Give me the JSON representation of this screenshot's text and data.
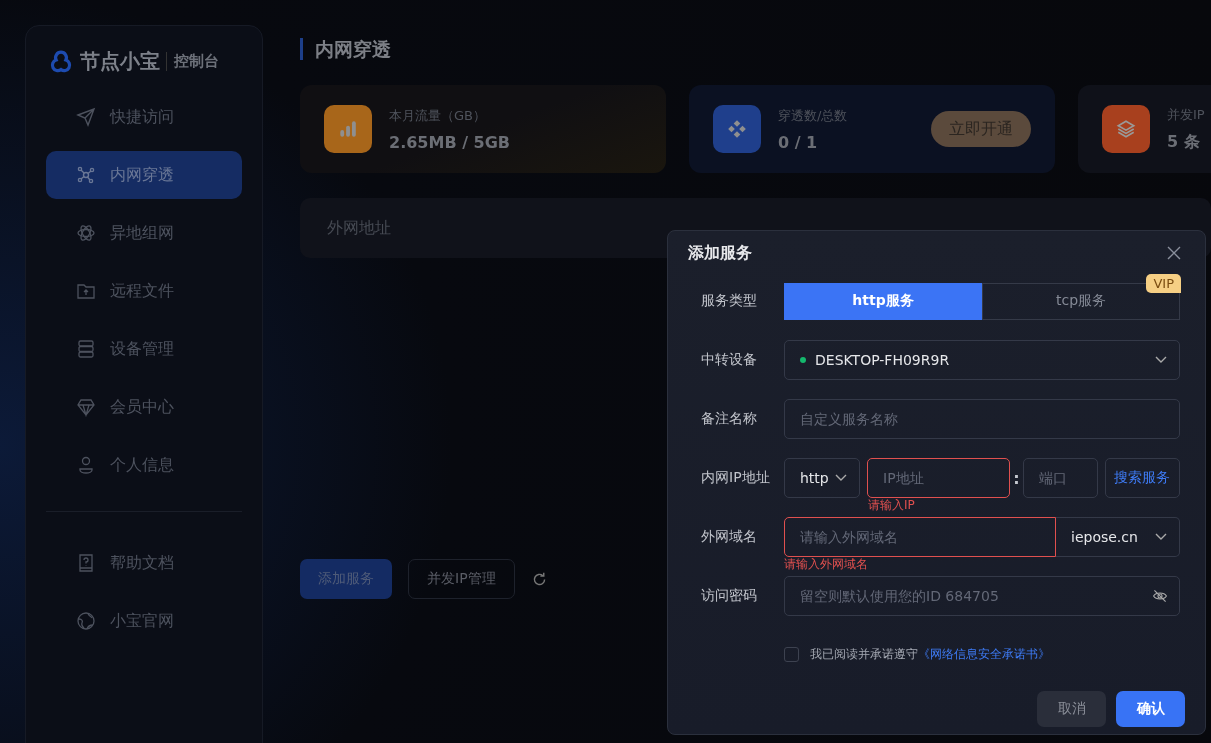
{
  "logo": {
    "name": "节点小宝",
    "subtitle": "控制台"
  },
  "sidebar": {
    "items": [
      {
        "label": "快捷访问",
        "selected": false
      },
      {
        "label": "内网穿透",
        "selected": true
      },
      {
        "label": "异地组网",
        "selected": false
      },
      {
        "label": "远程文件",
        "selected": false
      },
      {
        "label": "设备管理",
        "selected": false
      },
      {
        "label": "会员中心",
        "selected": false
      },
      {
        "label": "个人信息",
        "selected": false
      }
    ],
    "footer_items": [
      {
        "label": "帮助文档",
        "selected": false
      },
      {
        "label": "小宝官网",
        "selected": false
      }
    ]
  },
  "page_title": "内网穿透",
  "stats": [
    {
      "label": "本月流量（GB）",
      "value": "2.65MB / 5GB",
      "color": "#a8661a"
    },
    {
      "label": "穿透数/总数",
      "value": "0 / 1",
      "color": "#1f3f8c",
      "action": "立即开通"
    },
    {
      "label": "并发IP",
      "value": "5 条",
      "color": "#a8401e"
    }
  ],
  "table": {
    "columns": [
      "外网地址"
    ]
  },
  "actions": [
    {
      "label": "添加服务",
      "kind": "primary"
    },
    {
      "label": "并发IP管理",
      "kind": "outline"
    }
  ],
  "dialog": {
    "title": "添加服务",
    "service_type": {
      "label": "服务类型",
      "options": [
        {
          "label": "http服务",
          "selected": true
        },
        {
          "label": "tcp服务",
          "selected": false,
          "badge": "VIP"
        }
      ]
    },
    "relay_device": {
      "label": "中转设备",
      "value": "DESKTOP-FH09R9R",
      "online": true
    },
    "note_name": {
      "label": "备注名称",
      "placeholder": "自定义服务名称"
    },
    "lan_ip": {
      "label": "内网IP地址",
      "protocol": "http",
      "ip_placeholder": "IP地址",
      "separator": ":",
      "port_placeholder": "端口",
      "search": "搜索服务",
      "error": "请输入IP"
    },
    "domain": {
      "label": "外网域名",
      "placeholder": "请输入外网域名",
      "suffix": "iepose.cn",
      "error": "请输入外网域名"
    },
    "password": {
      "label": "访问密码",
      "placeholder": "留空则默认使用您的ID 684705"
    },
    "agreement": {
      "checked": false,
      "text": "我已阅读并承诺遵守",
      "link": "《网络信息安全承诺书》"
    },
    "buttons": {
      "cancel": "取消",
      "confirm": "确认"
    }
  }
}
